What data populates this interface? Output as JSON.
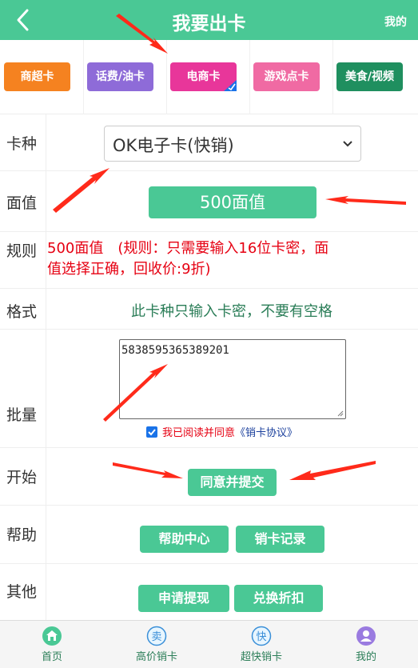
{
  "header": {
    "title": "我要出卡",
    "right_link": "我的"
  },
  "categories": [
    {
      "label": "商超卡",
      "color": "#f58220"
    },
    {
      "label": "话费/油卡",
      "color": "#8e6bd8"
    },
    {
      "label": "电商卡",
      "color": "#e8369a",
      "selected": true
    },
    {
      "label": "游戏点卡",
      "color": "#f06aa3"
    },
    {
      "label": "美食/视频",
      "color": "#1f8f5f"
    }
  ],
  "form": {
    "card_type": {
      "label": "卡种",
      "value": "OK电子卡(快销)"
    },
    "face_value": {
      "label": "面值",
      "value": "500面值"
    },
    "rules": {
      "label": "规则",
      "text": "500面值　(规则：只需要输入16位卡密，面值选择正确，回收价:9折)"
    },
    "format": {
      "label": "格式",
      "text": "此卡种只输入卡密，不要有空格"
    },
    "batch": {
      "label": "批量",
      "value": "5838595365389201",
      "agree_text": "我已阅读并同意",
      "agree_link": "《销卡协议》"
    },
    "start": {
      "label": "开始",
      "submit": "同意并提交"
    },
    "help": {
      "label": "帮助",
      "help_center": "帮助中心",
      "records": "销卡记录"
    },
    "other": {
      "label": "其他",
      "withdraw": "申请提现",
      "exchange": "兑换折扣"
    }
  },
  "bottom_nav": [
    {
      "label": "首页",
      "icon": "home-icon"
    },
    {
      "label": "高价销卡",
      "icon": "sell-icon"
    },
    {
      "label": "超快销卡",
      "icon": "fast-icon"
    },
    {
      "label": "我的",
      "icon": "user-icon"
    }
  ],
  "colors": {
    "primary": "#4ac895",
    "rule_red": "#e60012",
    "text_green": "#2a7d57"
  }
}
